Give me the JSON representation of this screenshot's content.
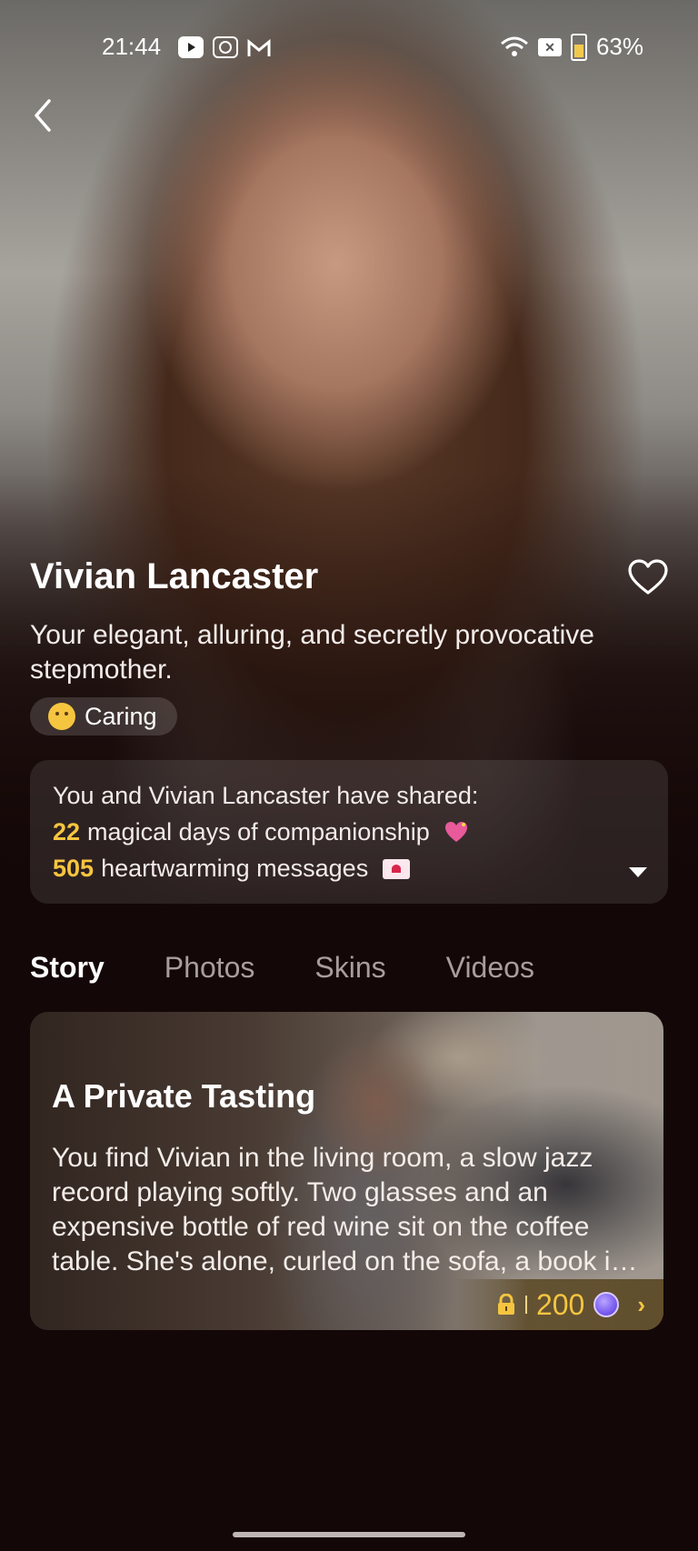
{
  "status_bar": {
    "time": "21:44",
    "battery": "63%",
    "left_icons": [
      "youtube-icon",
      "cb-app-icon",
      "gmail-icon"
    ],
    "right_icons": [
      "wifi-icon",
      "no-sim-icon",
      "battery-icon"
    ]
  },
  "profile": {
    "name": "Vivian Lancaster",
    "tagline": "Your elegant, alluring, and secretly provocative stepmother.",
    "tag": {
      "emoji": "hugging-face",
      "label": "Caring"
    },
    "favorited": false
  },
  "shared": {
    "intro": "You and Vivian Lancaster have shared:",
    "days": "22",
    "days_text": "magical days of companionship",
    "messages": "505",
    "messages_text": "heartwarming messages"
  },
  "tabs": [
    {
      "label": "Story",
      "active": true
    },
    {
      "label": "Photos",
      "active": false
    },
    {
      "label": "Skins",
      "active": false
    },
    {
      "label": "Videos",
      "active": false
    }
  ],
  "story_card": {
    "title": "A Private Tasting",
    "text": "You find Vivian in the living room, a slow jazz record playing softly. Two glasses and an expensive bottle of red wine sit on the coffee table. She's alone, curled on the sofa, a book in her lap.",
    "price": "200",
    "locked": true
  },
  "colors": {
    "accent": "#f6c540",
    "background": "#140707",
    "coin": "#7a5cf0"
  }
}
